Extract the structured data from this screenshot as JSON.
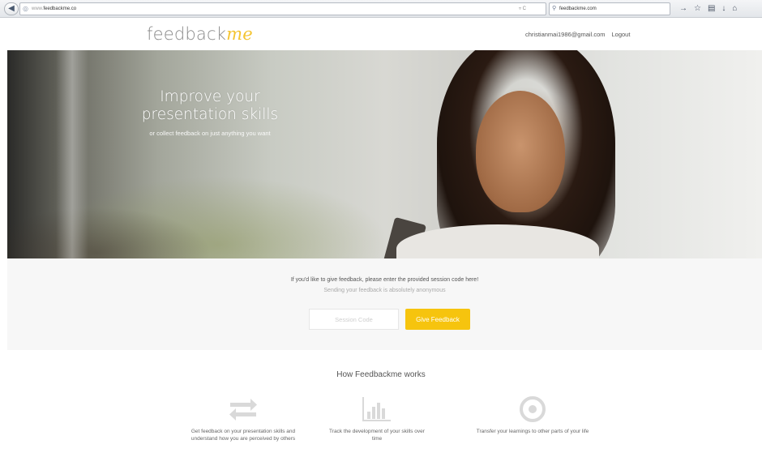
{
  "browser": {
    "url_prefix": "www.",
    "url_domain": "feedbackme.co",
    "search_text": "feedbackme.com",
    "url_tools": "▿ C"
  },
  "header": {
    "logo_main": "feedback",
    "logo_accent": "me",
    "user_email": "christianmai1986@gmail.com",
    "logout_label": "Logout"
  },
  "hero": {
    "title": "Improve your presentation skills",
    "subtitle": "or collect feedback on just anything you want"
  },
  "feedback": {
    "instruction": "If you'd like to give feedback, please enter the provided session code here!",
    "anonymous_note": "Sending your feedback is absolutely anonymous",
    "session_placeholder": "Session Code",
    "button_label": "Give Feedback"
  },
  "how": {
    "title": "How Feedbackme works",
    "features": [
      {
        "icon": "exchange-arrows-icon",
        "text": "Get feedback on your presentation skills and understand how you are perceived by others"
      },
      {
        "icon": "bar-chart-icon",
        "text": "Track the development of your skills over time"
      },
      {
        "icon": "target-icon",
        "text": "Transfer your learnings to other parts of your life"
      }
    ]
  },
  "colors": {
    "accent": "#f6c40e",
    "icon_grey": "#d9d9d9"
  }
}
